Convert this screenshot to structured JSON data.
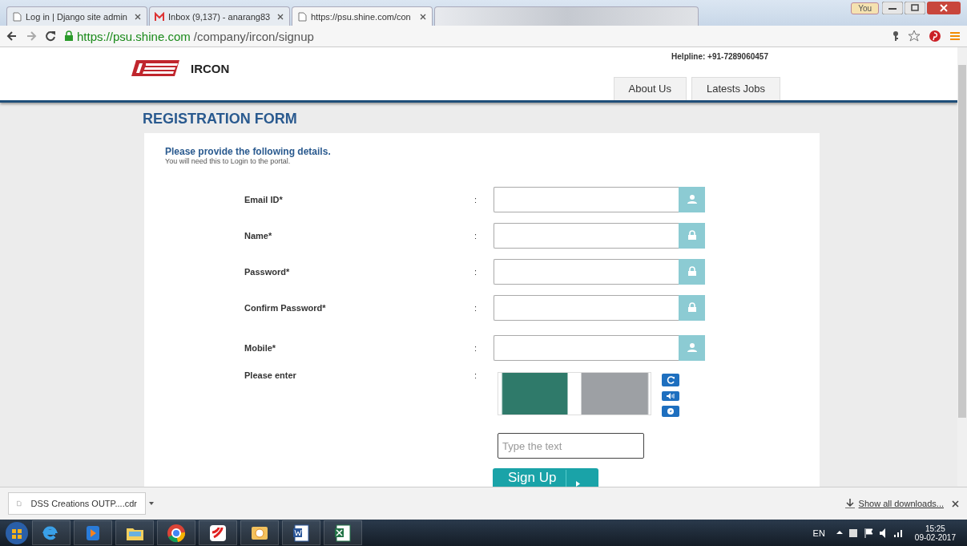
{
  "browser": {
    "tabs": [
      {
        "label": "Log in | Django site admin",
        "kind": "page",
        "selected": false
      },
      {
        "label": "Inbox (9,137) - anarang83",
        "kind": "mail",
        "selected": false
      },
      {
        "label": "https://psu.shine.com/con",
        "kind": "page",
        "selected": true
      }
    ],
    "profile": "You",
    "address": {
      "secure": true,
      "host": "https://psu.shine.com",
      "path": "/company/ircon/signup"
    }
  },
  "site": {
    "brand": "IRCON",
    "helpline": "Helpline: +91-7289060457",
    "nav": [
      {
        "label": "About Us"
      },
      {
        "label": "Latests Jobs"
      }
    ]
  },
  "form": {
    "title": "REGISTRATION FORM",
    "heading": "Please provide the following details.",
    "subheading": "You will need this to Login to the portal.",
    "fields": [
      {
        "label": "Email ID*",
        "separator": ":",
        "kind": "account"
      },
      {
        "label": "Name*",
        "separator": ":",
        "kind": "secret"
      },
      {
        "label": "Password*",
        "separator": ":",
        "kind": "secret"
      },
      {
        "label": "Confirm Password*",
        "separator": ":",
        "kind": "secret"
      },
      {
        "label": "Mobile*",
        "separator": ":",
        "kind": "account"
      }
    ],
    "captcha": {
      "label": "Please enter",
      "separator": ":",
      "placeholder": "Type the text"
    },
    "submit": "Sign Up"
  },
  "downloads": {
    "file": "DSS Creations OUTP....cdr",
    "show_all": "Show all downloads..."
  },
  "taskbar": {
    "language": "EN",
    "time": "15:25",
    "date": "09-02-2017"
  }
}
